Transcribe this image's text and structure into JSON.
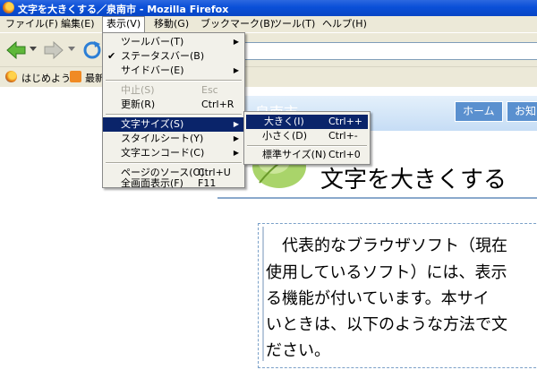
{
  "window": {
    "title": "文字を大きくする／泉南市 - Mozilla Firefox"
  },
  "menubar": [
    "ファイル(F)",
    "編集(E)",
    "表示(V)",
    "移動(G)",
    "ブックマーク(B)",
    "ツール(T)",
    "ヘルプ(H)"
  ],
  "bookmarks": {
    "item1": "はじめよう",
    "item2": "最新"
  },
  "view_menu": {
    "toolbar": "ツールバー(T)",
    "statusbar": "ステータスバー(B)",
    "sidebar": "サイドバー(E)",
    "stop": "中止(S)",
    "stop_sc": "Esc",
    "reload": "更新(R)",
    "reload_sc": "Ctrl+R",
    "text_size": "文字サイズ(S)",
    "style_sheet": "スタイルシート(Y)",
    "encoding": "文字エンコード(C)",
    "page_source": "ページのソース(O)",
    "page_source_sc": "Ctrl+U",
    "fullscreen": "全画面表示(F)",
    "fullscreen_sc": "F11"
  },
  "text_size_menu": {
    "larger": "大きく(I)",
    "larger_sc": "Ctrl++",
    "smaller": "小さく(D)",
    "smaller_sc": "Ctrl+-",
    "normal": "標準サイズ(N)",
    "normal_sc": "Ctrl+0"
  },
  "page": {
    "site_name": "泉南市",
    "nav": [
      "ホーム",
      "お知"
    ],
    "headline": "文字を大きくする",
    "para": [
      "　代表的なブラウザソフト（現在",
      "使用しているソフト）には、表示",
      "る機能が付いています。本サイ",
      "いときは、以下のような方法で文",
      "ださい。"
    ]
  },
  "colors": {
    "titlebar": "#0a4fd8",
    "highlight": "#0a246a",
    "menu_bg": "#ece9d8"
  }
}
